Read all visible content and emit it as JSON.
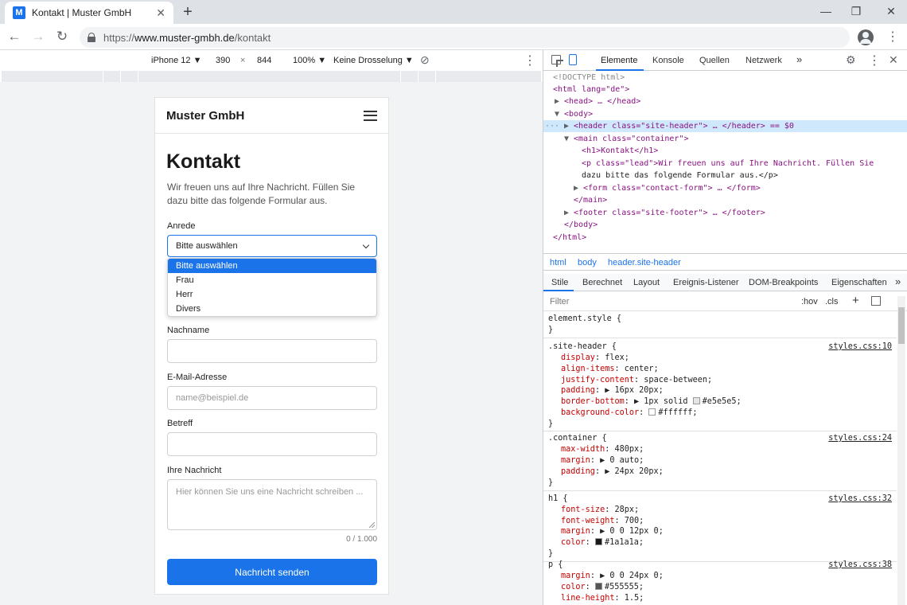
{
  "browser": {
    "tab_title": "Kontakt | Muster GmbH",
    "favicon_letter": "M",
    "new_tab": "+",
    "url_prefix": "https://",
    "url_host": "www.muster-gmbh.de",
    "url_path": "/kontakt"
  },
  "device_toolbar": {
    "device": "iPhone 12 ▼",
    "width": "390",
    "times": "×",
    "height": "844",
    "zoom": "100% ▼",
    "throttle": "Keine Drosselung ▼"
  },
  "page": {
    "brand": "Muster GmbH",
    "heading": "Kontakt",
    "lead": "Wir freuen uns auf Ihre Nachricht. Füllen Sie dazu bitte das folgende Formular aus.",
    "salutation_label": "Anrede",
    "salutation_value": "Bitte auswählen",
    "salutation_options": [
      "Bitte auswählen",
      "Frau",
      "Herr",
      "Divers"
    ],
    "lastname_label": "Nachname",
    "email_label": "E-Mail-Adresse",
    "email_placeholder": "name@beispiel.de",
    "subject_label": "Betreff",
    "message_label": "Ihre Nachricht",
    "message_placeholder": "Hier können Sie uns eine Nachricht schreiben ...",
    "counter": "0 / 1.000",
    "submit": "Nachricht senden"
  },
  "devtools": {
    "tabs": [
      "Elemente",
      "Konsole",
      "Quellen",
      "Netzwerk",
      "»"
    ],
    "breadcrumbs": [
      "html",
      "body",
      "header.site-header"
    ],
    "style_tabs": [
      "Stile",
      "Berechnet",
      "Layout",
      "Ereignis-Listener",
      "DOM-Breakpoints",
      "Eigenschaften",
      "»"
    ],
    "filter_placeholder": "Filter",
    "hov": ":hov",
    "cls": ".cls",
    "dom": {
      "doctype": "<!DOCTYPE html>",
      "html_open": "<html lang=\"de\">",
      "head": "<head> … </head>",
      "body_open": "<body>",
      "header": "<header class=\"site-header\"> … </header> == $0",
      "main_open": "<main class=\"container\">",
      "h1": "<h1>Kontakt</h1>",
      "p_line1": "<p class=\"lead\">Wir freuen uns auf Ihre Nachricht. Füllen Sie",
      "p_line2": "dazu bitte das folgende Formular aus.</p>",
      "form": "<form class=\"contact-form\"> … </form>",
      "main_close": "</main>",
      "footer": "<footer class=\"site-footer\"> … </footer>",
      "body_close": "</body>",
      "html_close": "</html>"
    },
    "rules": {
      "element_style": "element.style {",
      "close": "}",
      "r1": {
        "selector": ".site-header {",
        "source": "styles.css:10",
        "decls": [
          [
            "display",
            "flex;"
          ],
          [
            "align-items",
            "center;"
          ],
          [
            "justify-content",
            "space-between;"
          ],
          [
            "padding",
            "▶ 16px 20px;"
          ],
          [
            "border-bottom",
            "▶ 1px solid"
          ],
          [
            "background-color",
            ""
          ]
        ],
        "border_color": "#e5e5e5;",
        "bg_color": "#ffffff;"
      },
      "r2": {
        "selector": ".container {",
        "source": "styles.css:24",
        "decls": [
          [
            "max-width",
            "480px;"
          ],
          [
            "margin",
            "▶ 0 auto;"
          ],
          [
            "padding",
            "▶ 24px 20px;"
          ]
        ]
      },
      "r3": {
        "selector": "h1 {",
        "source": "styles.css:32",
        "decls": [
          [
            "font-size",
            "28px;"
          ],
          [
            "font-weight",
            "700;"
          ],
          [
            "margin",
            "▶ 0 0 12px 0;"
          ],
          [
            "color",
            ""
          ]
        ],
        "color_value": "#1a1a1a;"
      },
      "r4": {
        "selector": "p {",
        "source": "styles.css:38",
        "decls": [
          [
            "margin",
            "▶ 0 0 24px 0;"
          ],
          [
            "color",
            ""
          ],
          [
            "line-height",
            "1.5;"
          ]
        ],
        "color_value": "#555555;"
      }
    }
  },
  "colors": {
    "accent": "#1a73e8"
  }
}
